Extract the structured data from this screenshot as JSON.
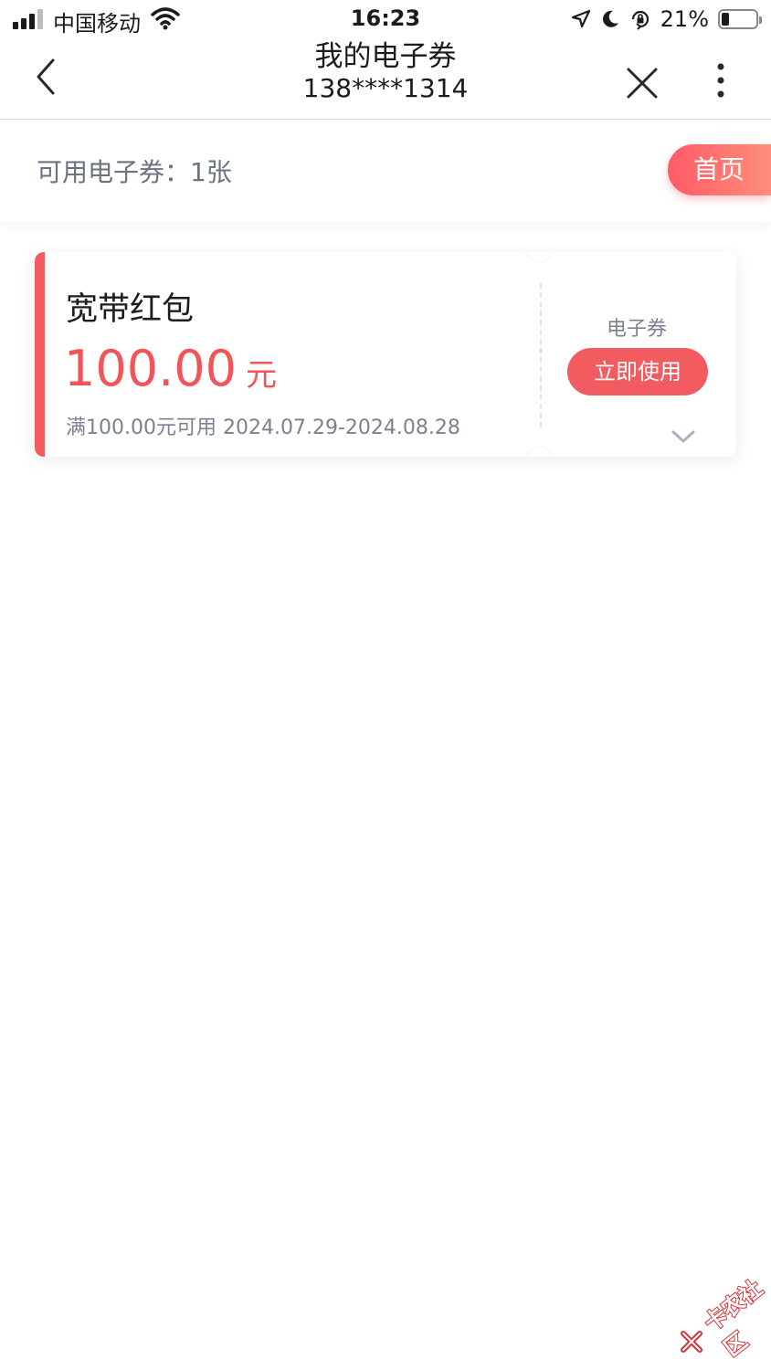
{
  "status_bar": {
    "carrier": "中国移动",
    "time": "16:23",
    "battery_percent": "21%",
    "battery_level": 0.21
  },
  "nav": {
    "title": "我的电子券",
    "subtitle": "138****1314"
  },
  "summary": {
    "label": "可用电子券：1张",
    "home_button": "首页"
  },
  "coupon": {
    "name": "宽带红包",
    "amount": "100.00",
    "unit": "元",
    "condition": "满100.00元可用 2024.07.29-2024.08.28",
    "type": "电子券",
    "use_button": "立即使用"
  },
  "colors": {
    "accent": "#f25b5f",
    "summary_text": "#6b7380",
    "muted_text": "#7b8190"
  },
  "icons": [
    "signal-icon",
    "wifi-icon",
    "location-icon",
    "moon-icon",
    "rotation-lock-icon",
    "battery-icon",
    "back-icon",
    "close-icon",
    "more-icon",
    "chevron-down-icon",
    "watermark-logo"
  ]
}
